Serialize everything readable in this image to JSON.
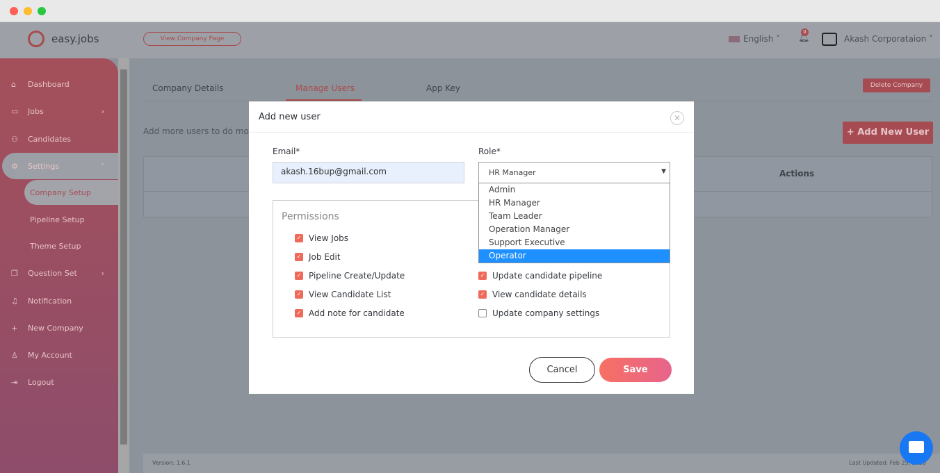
{
  "header": {
    "logo": "easy.jobs",
    "view_company": "View Company Page",
    "language": "English",
    "notifications": "0",
    "company": "Akash Corporataion"
  },
  "sidebar": {
    "items": [
      {
        "label": "Dashboard",
        "icon": "home-icon"
      },
      {
        "label": "Jobs",
        "icon": "briefcase-icon"
      },
      {
        "label": "Candidates",
        "icon": "users-icon"
      },
      {
        "label": "Settings",
        "icon": "gear-icon"
      },
      {
        "label": "Question Set",
        "icon": "copy-icon"
      },
      {
        "label": "Notification",
        "icon": "bell-icon"
      },
      {
        "label": "New Company",
        "icon": "plus-icon"
      },
      {
        "label": "My Account",
        "icon": "user-icon"
      },
      {
        "label": "Logout",
        "icon": "logout-icon"
      }
    ],
    "sub": [
      "Company Setup",
      "Pipeline Setup",
      "Theme Setup"
    ]
  },
  "tabs": [
    "Company Details",
    "Manage Users",
    "App Key"
  ],
  "main": {
    "delete_company": "Delete Company",
    "intro": "Add more users to do more",
    "add_new_user": "+ Add New User",
    "actions_header": "Actions"
  },
  "footer": {
    "version": "Version: 1.6.1",
    "updated": "Last Updated: Feb 25, 2020"
  },
  "modal": {
    "title": "Add new user",
    "email_label": "Email*",
    "email_value": "akash.16bup@gmail.com",
    "role_label": "Role*",
    "role_value": "HR Manager",
    "role_options": [
      "Admin",
      "HR Manager",
      "Team Leader",
      "Operation Manager",
      "Support Executive",
      "Operator"
    ],
    "highlighted_option": "Operator",
    "permissions_title": "Permissions",
    "permissions_left": [
      {
        "label": "View Jobs",
        "checked": true
      },
      {
        "label": "Job Edit",
        "checked": true
      },
      {
        "label": "Pipeline Create/Update",
        "checked": true
      },
      {
        "label": "View Candidate List",
        "checked": true
      },
      {
        "label": "Add note for candidate",
        "checked": true
      }
    ],
    "permissions_right": [
      {
        "label": "Update candidate pipeline",
        "checked": true
      },
      {
        "label": "View candidate details",
        "checked": true
      },
      {
        "label": "Update company settings",
        "checked": false
      }
    ],
    "cancel": "Cancel",
    "save": "Save"
  },
  "colors": {
    "accent": "#ef6a58",
    "highlight": "#1e90ff",
    "chat": "#1877f2"
  }
}
